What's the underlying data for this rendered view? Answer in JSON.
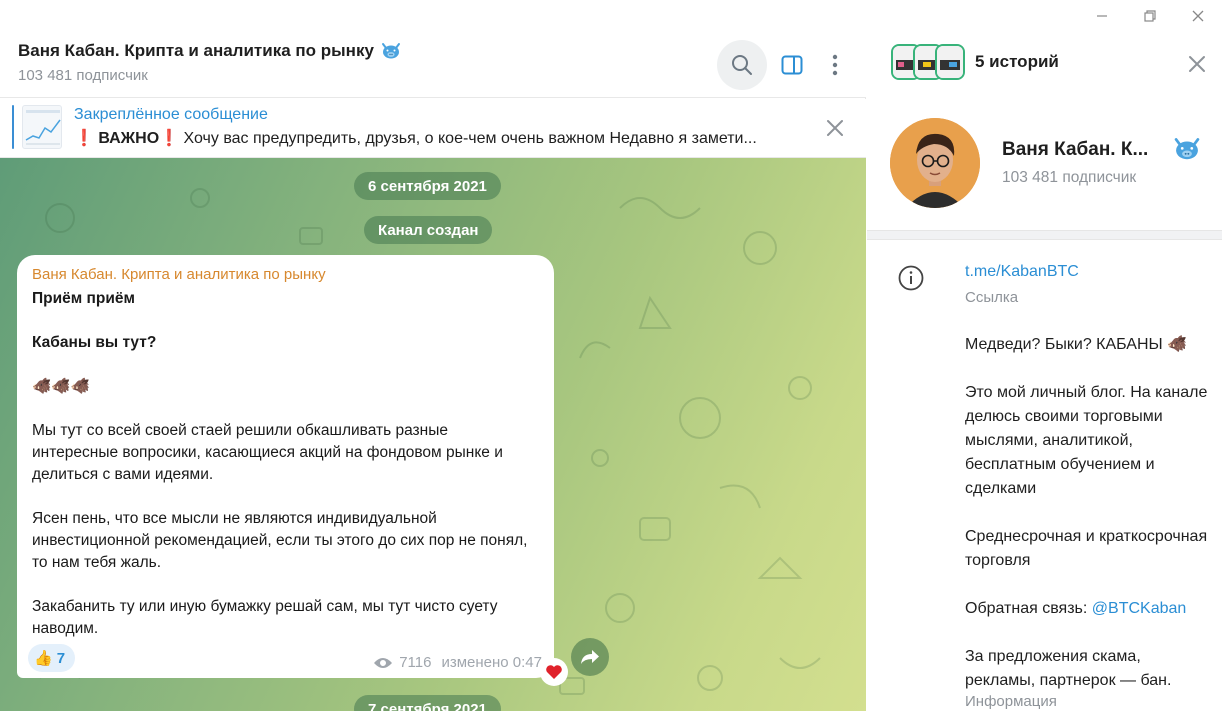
{
  "window": {
    "min_icon": "minimize-icon",
    "max_icon": "restore-icon",
    "close_icon": "close-icon"
  },
  "chat": {
    "title": "Ваня Кабан. Крипта и аналитика по рынку",
    "subtitle": "103 481 подписчик",
    "pinned": {
      "title": "Закреплённое сообщение",
      "text_bold": "❗ ВАЖНО❗",
      "text": " Хочу вас предупредить, друзья, о кое-чем очень важном  Недавно я замети..."
    },
    "dates": [
      "6 сентября 2021",
      "7 сентября 2021"
    ],
    "service_message": "Канал создан",
    "message": {
      "author": "Ваня Кабан. Крипта и аналитика по рынку",
      "line1": "Приём приём",
      "line2": "Кабаны вы тут?",
      "emojis": "🐗🐗🐗",
      "para1": "Мы тут со всей своей стаей решили обкашливать разные интересные вопросики, касающиеся акций на фондовом рынке и делиться с вами идеями.",
      "para2": "Ясен пень, что все мысли не являются индивидуальной инвестиционной рекомендацией, если ты этого до сих пор не понял, то нам тебя жаль.",
      "para3": "Закабанить ту или иную бумажку решай сам, мы тут чисто суету наводим.",
      "reaction_emoji": "👍",
      "reaction_count": "7",
      "views": "7116",
      "edited": "изменено 0:47"
    }
  },
  "info_panel": {
    "stories_label": "5 историй",
    "name": "Ваня Кабан. К...",
    "subtitle": "103 481 подписчик",
    "link": "t.me/KabanBTC",
    "link_label": "Ссылка",
    "about": {
      "l1": "Медведи? Быки? КАБАНЫ 🐗",
      "l2": "Это мой личный блог. На канале делюсь своими торговыми мыслями, аналитикой, бесплатным обучением и сделками",
      "l3": "Среднесрочная и краткосрочная торговля",
      "l4_prefix": "Обратная связь: ",
      "l4_mention": "@BTCKaban",
      "l5": "За предложения скама, рекламы, партнерок — бан."
    },
    "about_label": "Информация"
  },
  "colors": {
    "accent": "#2b8ed4",
    "author": "#d7882e",
    "story_ring": "#38b37a"
  }
}
